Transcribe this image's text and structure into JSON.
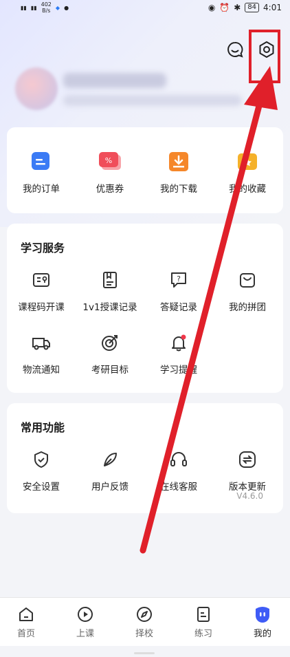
{
  "status_bar": {
    "network_speed": "402",
    "speed_unit": "B/s",
    "battery": "84",
    "time": "4:01"
  },
  "header": {
    "message_icon": "chat-bubble-icon",
    "settings_icon": "hexagon-gear-icon"
  },
  "orders_card": {
    "items": [
      {
        "label": "我的订单",
        "icon": "order-icon",
        "color": "#3b7bf5"
      },
      {
        "label": "优惠券",
        "icon": "coupon-icon",
        "color": "#f04e5a"
      },
      {
        "label": "我的下载",
        "icon": "download-icon",
        "color": "#f5872a"
      },
      {
        "label": "我的收藏",
        "icon": "favorite-icon",
        "color": "#f5b12a"
      }
    ]
  },
  "study_services": {
    "title": "学习服务",
    "items": [
      {
        "label": "课程码开课",
        "icon": "course-code-icon"
      },
      {
        "label": "1v1授课记录",
        "icon": "bookmark-doc-icon"
      },
      {
        "label": "答疑记录",
        "icon": "question-chat-icon"
      },
      {
        "label": "我的拼团",
        "icon": "shopping-bag-icon"
      },
      {
        "label": "物流通知",
        "icon": "truck-icon"
      },
      {
        "label": "考研目标",
        "icon": "target-icon"
      },
      {
        "label": "学习提醒",
        "icon": "bell-icon"
      }
    ]
  },
  "common_functions": {
    "title": "常用功能",
    "items": [
      {
        "label": "安全设置",
        "icon": "shield-icon"
      },
      {
        "label": "用户反馈",
        "icon": "feather-icon"
      },
      {
        "label": "在线客服",
        "icon": "headset-icon"
      },
      {
        "label": "版本更新",
        "icon": "swap-icon"
      }
    ],
    "version": "V4.6.0"
  },
  "tab_bar": {
    "tabs": [
      {
        "label": "首页",
        "icon": "home-icon"
      },
      {
        "label": "上课",
        "icon": "play-icon"
      },
      {
        "label": "择校",
        "icon": "compass-icon"
      },
      {
        "label": "练习",
        "icon": "practice-icon"
      },
      {
        "label": "我的",
        "icon": "profile-face-icon",
        "active": true
      }
    ]
  },
  "accent_color": "#3f5cf6",
  "annotation_color": "#e0202a"
}
